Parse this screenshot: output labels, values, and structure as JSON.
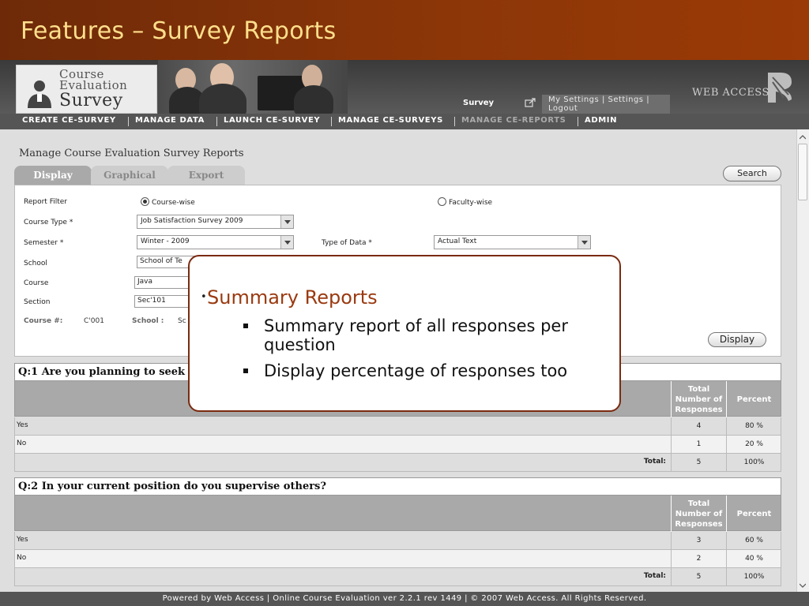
{
  "slide": {
    "title": "Features – Survey Reports"
  },
  "banner": {
    "logo_line1": "Course",
    "logo_line2": "Evaluation",
    "logo_line3": "Survey",
    "survey_label": "Survey",
    "settings_links": [
      "My Settings",
      "Settings",
      "Logout"
    ],
    "brand": "WEB ACCESS"
  },
  "nav": {
    "items": [
      {
        "label": "CREATE CE-SURVEY"
      },
      {
        "label": "MANAGE DATA"
      },
      {
        "label": "LAUNCH CE-SURVEY"
      },
      {
        "label": "MANAGE CE-SURVEYS"
      },
      {
        "label": "MANAGE CE-REPORTS"
      },
      {
        "label": "ADMIN"
      }
    ],
    "active_index": 4
  },
  "page": {
    "heading": "Manage Course Evaluation Survey Reports",
    "tabs": [
      "Display",
      "Graphical",
      "Export"
    ],
    "search_label": "Search",
    "display_label": "Display"
  },
  "filter": {
    "report_filter_label": "Report Filter",
    "option_course": "Course-wise",
    "option_faculty": "Faculty-wise",
    "course_type_label": "Course Type *",
    "course_type_value": "Job Satisfaction Survey 2009",
    "semester_label": "Semester *",
    "semester_value": "Winter - 2009",
    "type_of_data_label": "Type of Data *",
    "type_of_data_value": "Actual Text",
    "school_label": "School",
    "school_value": "School of Te",
    "course_label": "Course",
    "course_value": "Java",
    "section_label": "Section",
    "section_value": "Sec'101",
    "course_no_label": "Course #:",
    "course_no_value": "C'001",
    "school_info_label": "School :",
    "school_info_value": "Sc"
  },
  "table_headers": {
    "total": "Total Number of Responses",
    "percent": "Percent",
    "total_label": "Total:"
  },
  "questions": [
    {
      "title": "Q:1 Are you planning to seek",
      "rows": [
        {
          "answer": "Yes",
          "count": "4",
          "percent": "80 %"
        },
        {
          "answer": "No",
          "count": "1",
          "percent": "20 %"
        }
      ],
      "total_count": "5",
      "total_percent": "100%"
    },
    {
      "title": "Q:2 In your current position do you supervise others?",
      "rows": [
        {
          "answer": "Yes",
          "count": "3",
          "percent": "60 %"
        },
        {
          "answer": "No",
          "count": "2",
          "percent": "40 %"
        }
      ],
      "total_count": "5",
      "total_percent": "100%"
    }
  ],
  "footer": {
    "text": "Powered by Web Access | Online Course Evaluation ver 2.2.1 rev 1449 | © 2007 Web Access. All Rights Reserved."
  },
  "callout": {
    "bullet": "•",
    "heading": "Summary Reports",
    "items": [
      "Summary report of all responses per question",
      "Display  percentage of responses too"
    ]
  },
  "colors": {
    "title_band": "#8c3608",
    "title_text": "#ffdf8c",
    "callout_border": "#7a2a10",
    "callout_heading": "#9a3a10",
    "table_header": "#a9a9a9"
  }
}
